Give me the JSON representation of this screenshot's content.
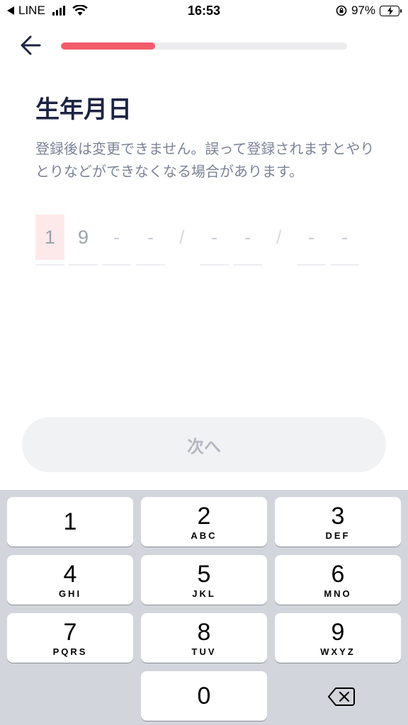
{
  "status_bar": {
    "carrier": "LINE",
    "time": "16:53",
    "battery_percent": "97%",
    "icons": [
      "back-to-app-icon",
      "signal-icon",
      "wifi-icon",
      "orientation-lock-icon",
      "battery-charging-icon"
    ]
  },
  "header": {
    "back_icon": "arrow-left-icon",
    "progress": 0.33,
    "progress_color": "#f25c6b"
  },
  "title": "生年月日",
  "description": "登録後は変更できません。誤って登録されますとやりとりなどができなくなる場合があります。",
  "date_input": {
    "digits": [
      "1",
      "9",
      "-",
      "-",
      "-",
      "-",
      "-",
      "-"
    ],
    "separator": "/",
    "active_index": 0
  },
  "next_button": {
    "label": "次へ"
  },
  "keypad": {
    "keys": [
      {
        "digit": "1",
        "letters": ""
      },
      {
        "digit": "2",
        "letters": "ABC"
      },
      {
        "digit": "3",
        "letters": "DEF"
      },
      {
        "digit": "4",
        "letters": "GHI"
      },
      {
        "digit": "5",
        "letters": "JKL"
      },
      {
        "digit": "6",
        "letters": "MNO"
      },
      {
        "digit": "7",
        "letters": "PQRS"
      },
      {
        "digit": "8",
        "letters": "TUV"
      },
      {
        "digit": "9",
        "letters": "WXYZ"
      },
      {
        "digit": "0",
        "letters": ""
      }
    ],
    "delete_icon": "backspace-icon"
  },
  "colors": {
    "accent": "#f25c6b",
    "title": "#1c2442",
    "text_muted": "#7b8397",
    "keyboard_bg": "#d2d5db"
  }
}
